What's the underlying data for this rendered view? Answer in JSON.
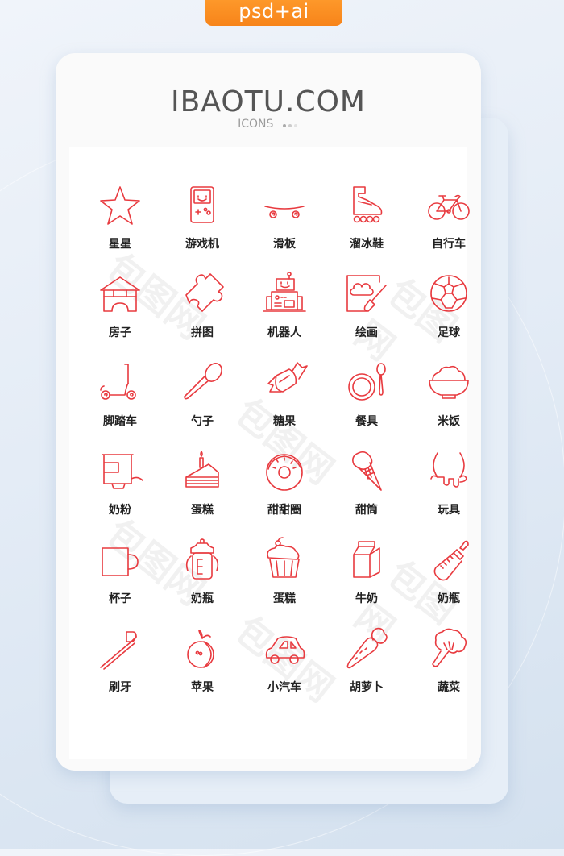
{
  "badge": {
    "label": "psd+ai",
    "color": "#f7881f"
  },
  "brand": {
    "title": "IBAOTU.COM",
    "subtitle": "ICONS"
  },
  "stroke_color": "#e83a3f",
  "watermark": "包图网",
  "icons": [
    {
      "icon": "star-icon",
      "label": "星星"
    },
    {
      "icon": "game-console-icon",
      "label": "游戏机"
    },
    {
      "icon": "skateboard-icon",
      "label": "滑板"
    },
    {
      "icon": "roller-skate-icon",
      "label": "溜冰鞋"
    },
    {
      "icon": "bicycle-icon",
      "label": "自行车"
    },
    {
      "icon": "house-icon",
      "label": "房子"
    },
    {
      "icon": "puzzle-icon",
      "label": "拼图"
    },
    {
      "icon": "robot-icon",
      "label": "机器人"
    },
    {
      "icon": "painting-icon",
      "label": "绘画"
    },
    {
      "icon": "football-icon",
      "label": "足球"
    },
    {
      "icon": "scooter-icon",
      "label": "脚踏车"
    },
    {
      "icon": "spoon-icon",
      "label": "勺子"
    },
    {
      "icon": "candy-icon",
      "label": "糖果"
    },
    {
      "icon": "tableware-icon",
      "label": "餐具"
    },
    {
      "icon": "rice-bowl-icon",
      "label": "米饭"
    },
    {
      "icon": "milk-powder-icon",
      "label": "奶粉"
    },
    {
      "icon": "cake-slice-icon",
      "label": "蛋糕"
    },
    {
      "icon": "donut-icon",
      "label": "甜甜圈"
    },
    {
      "icon": "ice-cream-cone-icon",
      "label": "甜筒"
    },
    {
      "icon": "udder-icon",
      "label": "玩具"
    },
    {
      "icon": "mug-icon",
      "label": "杯子"
    },
    {
      "icon": "feeding-bottle-icon",
      "label": "奶瓶"
    },
    {
      "icon": "cupcake-icon",
      "label": "蛋糕"
    },
    {
      "icon": "milk-carton-icon",
      "label": "牛奶"
    },
    {
      "icon": "baby-bottle-icon",
      "label": "奶瓶"
    },
    {
      "icon": "toothbrush-icon",
      "label": "刷牙"
    },
    {
      "icon": "apple-icon",
      "label": "苹果"
    },
    {
      "icon": "toy-car-icon",
      "label": "小汽车"
    },
    {
      "icon": "carrot-icon",
      "label": "胡萝卜"
    },
    {
      "icon": "broccoli-icon",
      "label": "蔬菜"
    }
  ]
}
